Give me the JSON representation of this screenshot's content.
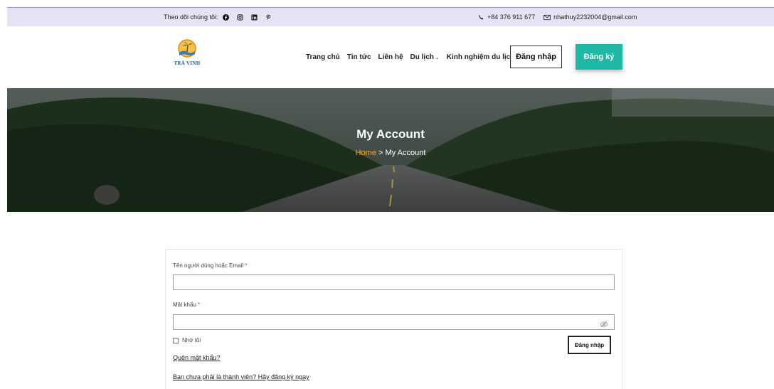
{
  "topbar": {
    "follow_label": "Theo dõi chúng tôi:",
    "social_icons": [
      "facebook-icon",
      "instagram-icon",
      "linkedin-icon",
      "pinterest-icon"
    ],
    "phone": "+84 376 911 677",
    "email": "nhathuy2232004@gmail.com"
  },
  "header": {
    "logo_text": "TRÀ VINH",
    "nav": [
      {
        "label": "Trang chủ"
      },
      {
        "label": "Tin tức"
      },
      {
        "label": "Liên hệ"
      },
      {
        "label": "Du lịch"
      },
      {
        "label": "Kinh nghiệm du lịch"
      }
    ],
    "login_label": "Đăng nhập",
    "register_label": "Đăng ký"
  },
  "hero": {
    "title": "My Account",
    "breadcrumb_home": "Home",
    "breadcrumb_sep": ">",
    "breadcrumb_current": "My Account"
  },
  "form": {
    "username_label": "Tên người dùng hoặc Email",
    "username_value": "",
    "password_label": "Mật khẩu",
    "password_value": "",
    "required_mark": "*",
    "remember_label": "Nhớ tôi",
    "submit_label": "Đăng nhập",
    "forgot_link": "Quên mật khẩu?",
    "register_link": "Bạn chưa phải là thành viên? Hãy đăng ký ngay"
  },
  "colors": {
    "topbar_bg": "#e7e2f4",
    "accent": "#1fb7a6",
    "breadcrumb_home": "#f6a623",
    "required": "#e0433a"
  }
}
